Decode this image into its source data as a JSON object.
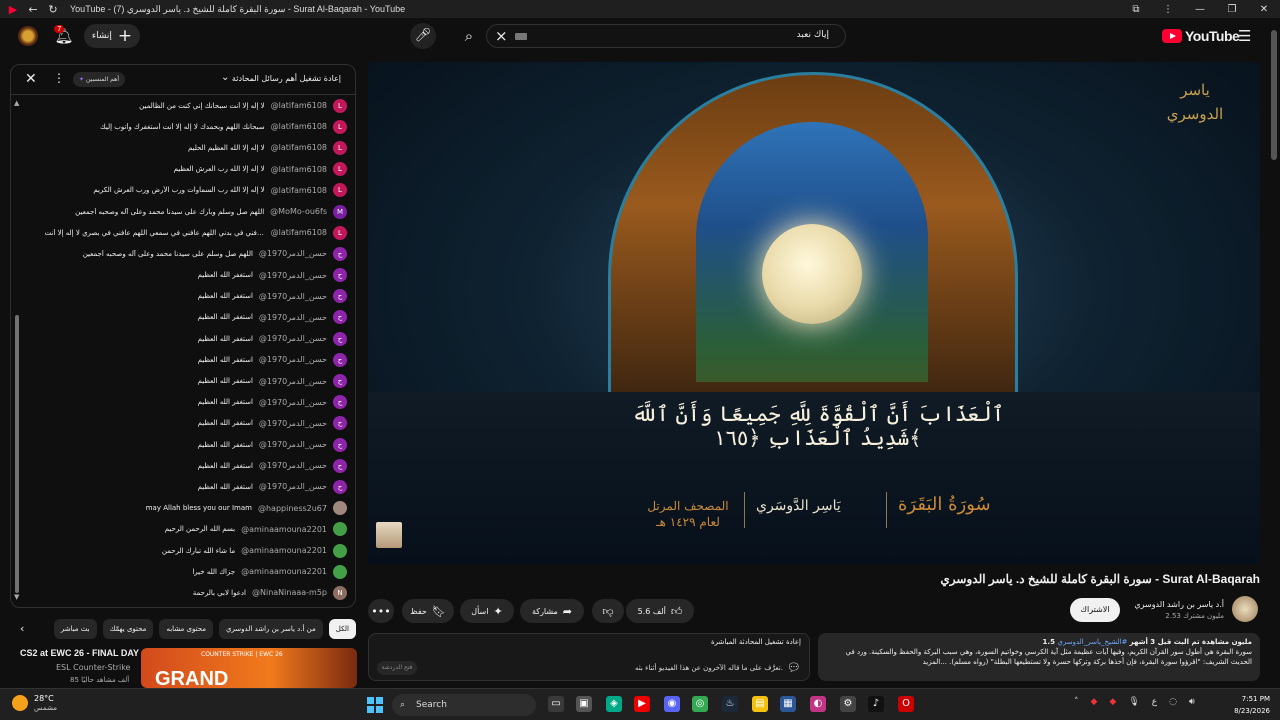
{
  "browser": {
    "title": "YouTube - سورة البقرة كاملة للشيخ د. ياسر الدوسري (7) - Surat Al-Baqarah - YouTube"
  },
  "topbar": {
    "create_label": "إنشاء",
    "notif_count": "7",
    "search_query": "إياك نعبد",
    "logo_word": "YouTube"
  },
  "player": {
    "verse": "ٱلْعَذَابَ أَنَّ ٱلْقُوَّةَ لِلَّهِ جَمِيعًا وَأَنَّ ٱللَّهَ شَدِيدُ ٱلْعَذَابِ ﴿١٦٥﴾",
    "calligraphy_surah": "سُورَةُ البَقَرَة",
    "calligraphy_reciter": "يَاسِر الدَّوسَري",
    "calligraphy_mushaf": "المصحف المرتل لعام ١٤٢٩ هـ",
    "brand": "ياسر الدوسري"
  },
  "video": {
    "title": "سورة البقرة كاملة للشيخ د. ياسر الدوسري - Surat Al-Baqarah",
    "channel": "أ.د ياسر بن راشد الدوسري",
    "subscribers": "2.53 مليون مشترك",
    "subscribe_label": "الاشتراك",
    "likes": "5.6 ألف",
    "share_label": "مشاركة",
    "ask_label": "اسأل",
    "save_label": "حفظ"
  },
  "description": {
    "stats": "1.5 مليون مشاهدة  تم البث قبل 3 أشهر",
    "tags": "#الشيخ_ياسر_الدوسري",
    "text": "سورة البقرة هي أطول سور القرآن الكريم، وفيها آيات عظيمة مثل آية الكرسي وخواتيم السورة، وهي سبب البركة والحفظ والسكينة. ورد في الحديث الشريف: \"اقرؤوا سورة البقرة، فإن أخذها بركة وتركها حسرة ولا تستطيعها البطلة\" (رواه مسلم). ...المزيد"
  },
  "replay_card": {
    "title": "إعادة تشغيل المحادثة المباشرة",
    "message": "تعرَّف على ما قاله الآخرون عن هذا الفيديو أثناء بثه.",
    "button": "فتح الدردشة"
  },
  "chat": {
    "header_mode": "إعادة تشغيل أهم رسائل المحادثة",
    "badge": "أهم المنسبين",
    "messages": [
      {
        "author": "@latifam6108",
        "text": "لا إله إلا أنت سبحانك إني كنت من الظالمين",
        "initial": "L",
        "color": "#c2185b"
      },
      {
        "author": "@latifam6108",
        "text": "سبحانك اللهم وبحمدك لا إله إلا أنت أستغفرك وأتوب إليك",
        "initial": "L",
        "color": "#c2185b"
      },
      {
        "author": "@latifam6108",
        "text": "لا إله إلا الله العظيم الحليم",
        "initial": "L",
        "color": "#c2185b"
      },
      {
        "author": "@latifam6108",
        "text": "لا إله إلا الله رب العرش العظيم",
        "initial": "L",
        "color": "#c2185b"
      },
      {
        "author": "@latifam6108",
        "text": "لا إله إلا الله رب السماوات ورب الأرض ورب العرش الكريم",
        "initial": "L",
        "color": "#c2185b"
      },
      {
        "author": "@MoMo-ou6fs",
        "text": "اللهم صل وسلم وبارك على سيدنا محمد وعلى آله وصحبه أجمعين",
        "initial": "M",
        "color": "#7b1fa2"
      },
      {
        "author": "@latifam6108",
        "text": "اللهم عافني في بدني اللهم عافني في سمعي اللهم عافني في بصري لا إله إلا أنت",
        "initial": "L",
        "color": "#c2185b"
      },
      {
        "author": "@حسن_الدمر1970",
        "text": "اللهم صل وسلم على سيدنا محمد وعلى آله وصحبه أجمعين",
        "initial": "ح",
        "color": "#8e24aa"
      },
      {
        "author": "@حسن_الدمر1970",
        "text": "استغفر الله العظيم",
        "initial": "ح",
        "color": "#8e24aa"
      },
      {
        "author": "@حسن_الدمر1970",
        "text": "استغفر الله العظيم",
        "initial": "ح",
        "color": "#8e24aa"
      },
      {
        "author": "@حسن_الدمر1970",
        "text": "استغفر الله العظيم",
        "initial": "ح",
        "color": "#8e24aa"
      },
      {
        "author": "@حسن_الدمر1970",
        "text": "استغفر الله العظيم",
        "initial": "ح",
        "color": "#8e24aa"
      },
      {
        "author": "@حسن_الدمر1970",
        "text": "استغفر الله العظيم",
        "initial": "ح",
        "color": "#8e24aa"
      },
      {
        "author": "@حسن_الدمر1970",
        "text": "استغفر الله العظيم",
        "initial": "ح",
        "color": "#8e24aa"
      },
      {
        "author": "@حسن_الدمر1970",
        "text": "استغفر الله العظيم",
        "initial": "ح",
        "color": "#8e24aa"
      },
      {
        "author": "@حسن_الدمر1970",
        "text": "استغفر الله العظيم",
        "initial": "ح",
        "color": "#8e24aa"
      },
      {
        "author": "@حسن_الدمر1970",
        "text": "استغفر الله العظيم",
        "initial": "ح",
        "color": "#8e24aa"
      },
      {
        "author": "@حسن_الدمر1970",
        "text": "استغفر الله العظيم",
        "initial": "ح",
        "color": "#8e24aa"
      },
      {
        "author": "@حسن_الدمر1970",
        "text": "استغفر الله العظيم",
        "initial": "ح",
        "color": "#8e24aa"
      },
      {
        "author": "@happiness2u67",
        "text": "may Allah bless you our Imam",
        "initial": "",
        "color": "#a1887f"
      },
      {
        "author": "@aminaamouna2201",
        "text": "بسم الله الرحمن الرحيم",
        "initial": "",
        "color": "#43a047"
      },
      {
        "author": "@aminaamouna2201",
        "text": "ما شاء الله تبارك الرحمن",
        "initial": "",
        "color": "#43a047"
      },
      {
        "author": "@aminaamouna2201",
        "text": "جزاك الله خيرا",
        "initial": "",
        "color": "#43a047"
      },
      {
        "author": "@NinaNinaaa-m5p",
        "text": "ادعوا لابي بالرحمة",
        "initial": "N",
        "color": "#8d6e63"
      }
    ]
  },
  "chips": [
    "الكل",
    "من أ.د ياسر بن راشد الدوسري",
    "محتوى مشابه",
    "محتوى يهمّك",
    "بث مباشر"
  ],
  "recommended": {
    "title": "CS2 at EWC 26 - FINAL DAY",
    "channel": "ESL Counter-Strike",
    "views": "85 ألف مشاهد حاليًا",
    "thumb_text": "GRAND",
    "thumb_tag": "COUNTER STRIKE | EWC 26"
  },
  "taskbar": {
    "temp": "28°C",
    "weather": "مشمس",
    "search": "Search",
    "time": "7:51 PM",
    "date": "8/23/2026",
    "lang": "ع"
  }
}
